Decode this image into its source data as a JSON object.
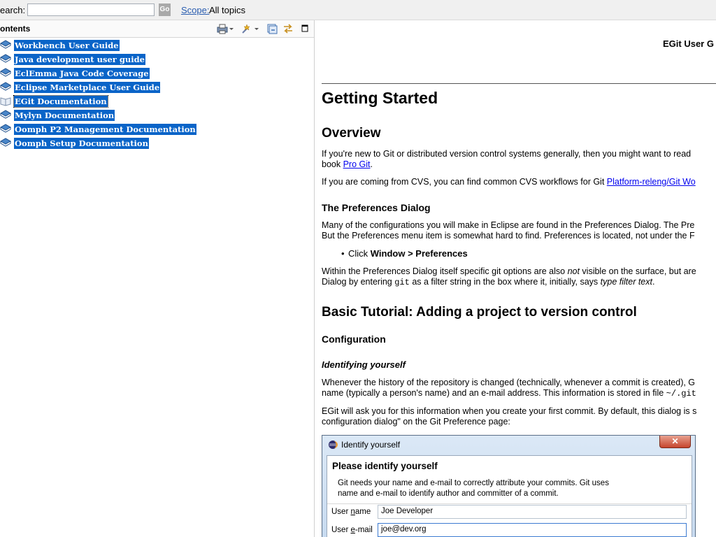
{
  "search": {
    "label": "earch:",
    "value": "",
    "go_label": "Go",
    "scope_label": "Scope:",
    "scope_value": "All topics"
  },
  "contents": {
    "title": "ontents",
    "items": [
      {
        "label": "Workbench User Guide"
      },
      {
        "label": "Java development user guide"
      },
      {
        "label": "EclEmma Java Code Coverage"
      },
      {
        "label": "Eclipse Marketplace User Guide"
      },
      {
        "label": "EGit Documentation"
      },
      {
        "label": "Mylyn Documentation"
      },
      {
        "label": "Oomph P2 Management Documentation"
      },
      {
        "label": "Oomph Setup Documentation"
      }
    ]
  },
  "doc": {
    "header": "EGit User G",
    "title": "Getting Started",
    "overview_heading": "Overview",
    "overview_p1_line1": "If you're new to Git or distributed version control systems generally, then you might want to read",
    "overview_p1_line2_pre": "book ",
    "overview_p1_link": "Pro Git",
    "overview_p1_line2_post": ".",
    "overview_p2_pre": "If you are coming from CVS, you can find common CVS workflows for Git ",
    "overview_p2_link": "Platform-releng/Git Wo",
    "prefs_heading": "The Preferences Dialog",
    "prefs_p1_line1": "Many of the configurations you will make in Eclipse are found in the Preferences Dialog. The Pre",
    "prefs_p1_line2": "But the Preferences menu item is somewhat hard to find. Preferences is located, not under the F",
    "prefs_bullet_pre": "Click ",
    "prefs_bullet_bold": "Window > Preferences",
    "prefs_p2_line1_pre": "Within the Preferences Dialog itself specific git options are also ",
    "prefs_p2_line1_em": "not",
    "prefs_p2_line1_post": " visible on the surface, but are",
    "prefs_p2_line2_pre": "Dialog by entering ",
    "prefs_p2_line2_code": "git",
    "prefs_p2_line2_mid": " as a filter string in the box where it, initially, says ",
    "prefs_p2_line2_em": "type filter text",
    "prefs_p2_line2_post": ".",
    "tutorial_heading": "Basic Tutorial: Adding a project to version control",
    "config_heading": "Configuration",
    "identify_heading": "Identifying yourself",
    "ident_p1_line1": "Whenever the history of the repository is changed (technically, whenever a commit is created), G",
    "ident_p1_line2_pre": "name (typically a person's name) and an e-mail address. This information is stored in file ",
    "ident_p1_line2_code": "~/.git",
    "ident_p2_line1": "EGit will ask you for this information when you create your first commit. By default, this dialog is s",
    "ident_p2_line2": "configuration dialog\" on the Git Preference page:"
  },
  "dialog": {
    "title": "Identify yourself",
    "close_label": "✕",
    "heading": "Please identify yourself",
    "desc_line1": "Git needs your name and e-mail to correctly attribute your commits. Git uses",
    "desc_line2": "name and e-mail to identify author and committer of a commit.",
    "user_name_label_pre": "User ",
    "user_name_label_u": "n",
    "user_name_label_post": "ame",
    "user_name_value": "Joe Developer",
    "user_email_label_pre": "User ",
    "user_email_label_u": "e",
    "user_email_label_post": "-mail",
    "user_email_value": "joe@dev.org"
  },
  "colors": {
    "selection": "#0a64c8",
    "link": "#0000ee",
    "scope_link": "#2a5db0"
  }
}
